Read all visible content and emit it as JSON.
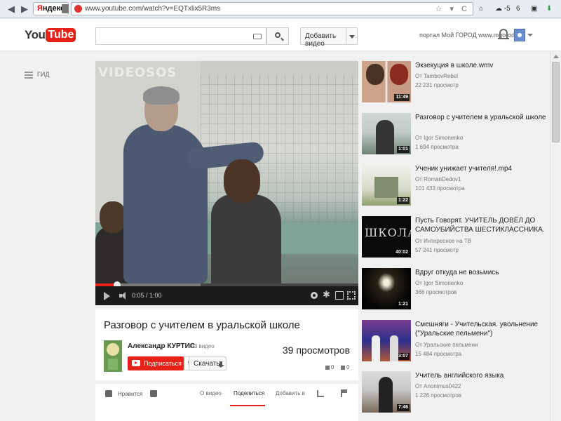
{
  "browser": {
    "yandex_label_y": "Я",
    "yandex_label_rest": "ндекс",
    "url": "www.youtube.com/watch?v=EQTxlix5R3ms",
    "toolbar_icons": "☆ ▾ C",
    "ext_weather": "☁ -5",
    "ext_mail": "6"
  },
  "header": {
    "logo_you": "You",
    "logo_tube": "Tube",
    "search_placeholder": "",
    "upload_label": "Добавить видео",
    "portal_text": "портал Мой ГОРОД www.mgorod.kz"
  },
  "guide": {
    "label": "ГИД"
  },
  "player": {
    "watermark": "VIDEOSOS",
    "time": "0:05 / 1:00",
    "progress_fraction": 0.083,
    "buffered_fraction": 0.4
  },
  "video": {
    "title": "Разговор с учителем в уральской школе",
    "channel": "Александр КУРТИС",
    "channel_video_count": "· 393 видео",
    "subscribe_label": "Подписаться",
    "subscriber_count": "9",
    "download_label": "Скачать",
    "views": "39 просмотров",
    "likes": "0",
    "dislikes": "0"
  },
  "actions": {
    "like_label": "Нравится",
    "tab_about": "О видео",
    "tab_share": "Поделиться",
    "tab_add": "Добавить в"
  },
  "related": [
    {
      "title": "Экзекуция в школе.wmv",
      "channel": "От TambovRebel",
      "views": "22 231 просмотр",
      "duration": "11:49"
    },
    {
      "title": "Разговор с учителем в уральской школе",
      "channel": "От Igor Simonenko",
      "views": "1 694 просмотра",
      "duration": "1:01"
    },
    {
      "title": "Ученик унижает учителя!.mp4",
      "channel": "От RomanDedov1",
      "views": "101 433 просмотра",
      "duration": "1:22"
    },
    {
      "title": "Пусть Говорят. УЧИТЕЛЬ ДОВЁЛ ДО САМОУБИЙСТВА ШЕСТИКЛАССНИКА.",
      "channel": "От Интересное на ТВ",
      "views": "57 241 просмотр",
      "duration": "40:02"
    },
    {
      "title": "Вдруг откуда не возьмись",
      "channel": "От Igor Simonenko",
      "views": "366 просмотров",
      "duration": "1:21"
    },
    {
      "title": "Смешняги - Учительская. увольнение (\"Уральские пельмени\")",
      "channel": "От Уральские пельмени",
      "views": "15 484 просмотра",
      "duration": "3:07"
    },
    {
      "title": "Учитель английского языка",
      "channel": "От Anonimus0422",
      "views": "1 226 просмотров",
      "duration": "7:46"
    }
  ]
}
